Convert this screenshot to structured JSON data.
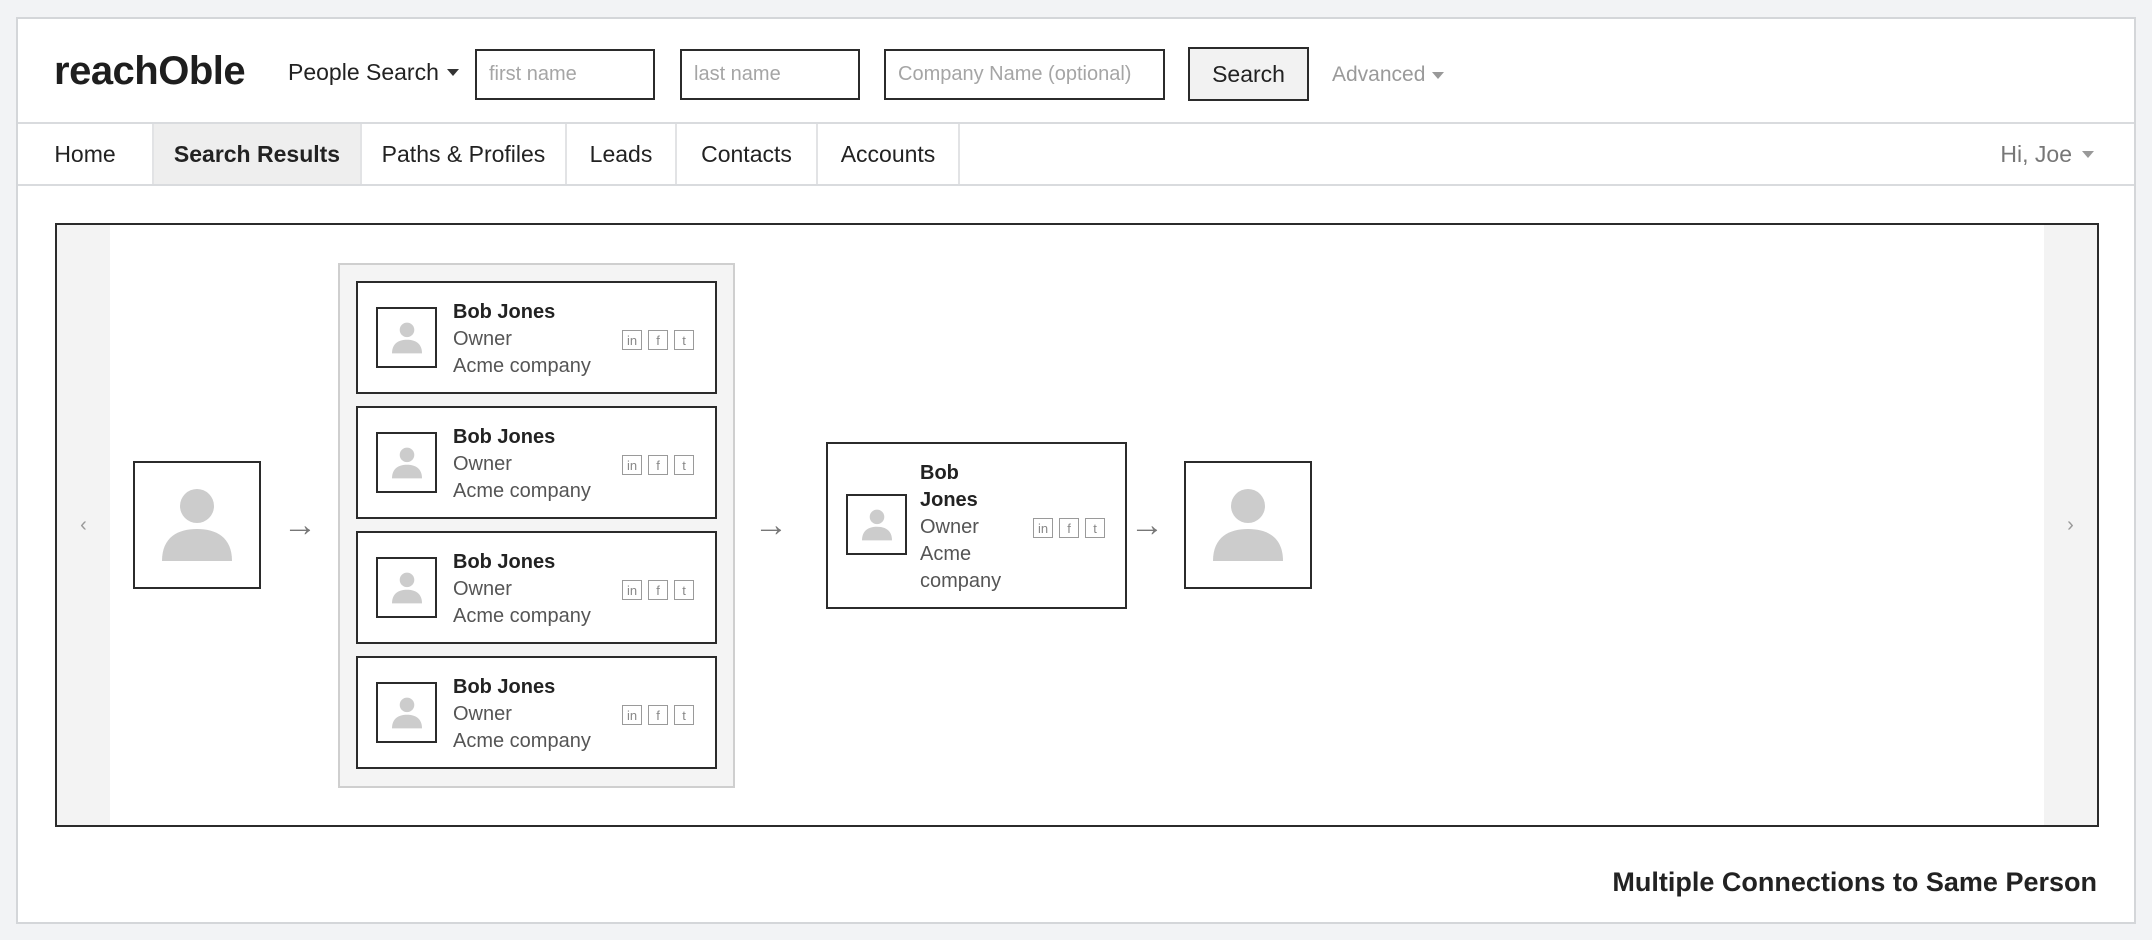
{
  "app": {
    "logo": "reachOble"
  },
  "header": {
    "search_type": "People Search",
    "first_name_placeholder": "first name",
    "last_name_placeholder": "last name",
    "company_placeholder": "Company Name (optional)",
    "search_button": "Search",
    "advanced_label": "Advanced"
  },
  "nav": {
    "tabs": [
      {
        "label": "Home"
      },
      {
        "label": "Search Results",
        "active": true
      },
      {
        "label": "Paths & Profiles"
      },
      {
        "label": "Leads"
      },
      {
        "label": "Contacts"
      },
      {
        "label": "Accounts"
      }
    ],
    "greeting": "Hi, Joe"
  },
  "carousel": {
    "prev_glyph": "‹",
    "next_glyph": "›",
    "arrow_glyph": "→",
    "connections": [
      {
        "name": "Bob Jones",
        "title": "Owner",
        "company": "Acme company"
      },
      {
        "name": "Bob Jones",
        "title": "Owner",
        "company": "Acme company"
      },
      {
        "name": "Bob Jones",
        "title": "Owner",
        "company": "Acme company"
      },
      {
        "name": "Bob Jones",
        "title": "Owner",
        "company": "Acme company"
      }
    ],
    "middle_person": {
      "name": "Bob Jones",
      "title": "Owner",
      "company": "Acme company"
    },
    "social_labels": [
      "in",
      "f",
      "t"
    ]
  },
  "caption": "Multiple Connections to Same Person",
  "colors": {
    "border": "#2b2b2b",
    "avatar_grey": "#cccccc",
    "active_tab_bg": "#eeeeee"
  },
  "icons": [
    "person-avatar-icon",
    "caret-down-icon",
    "linkedin-icon",
    "facebook-icon",
    "twitter-icon",
    "arrow-right-icon",
    "chevron-left-icon",
    "chevron-right-icon"
  ]
}
